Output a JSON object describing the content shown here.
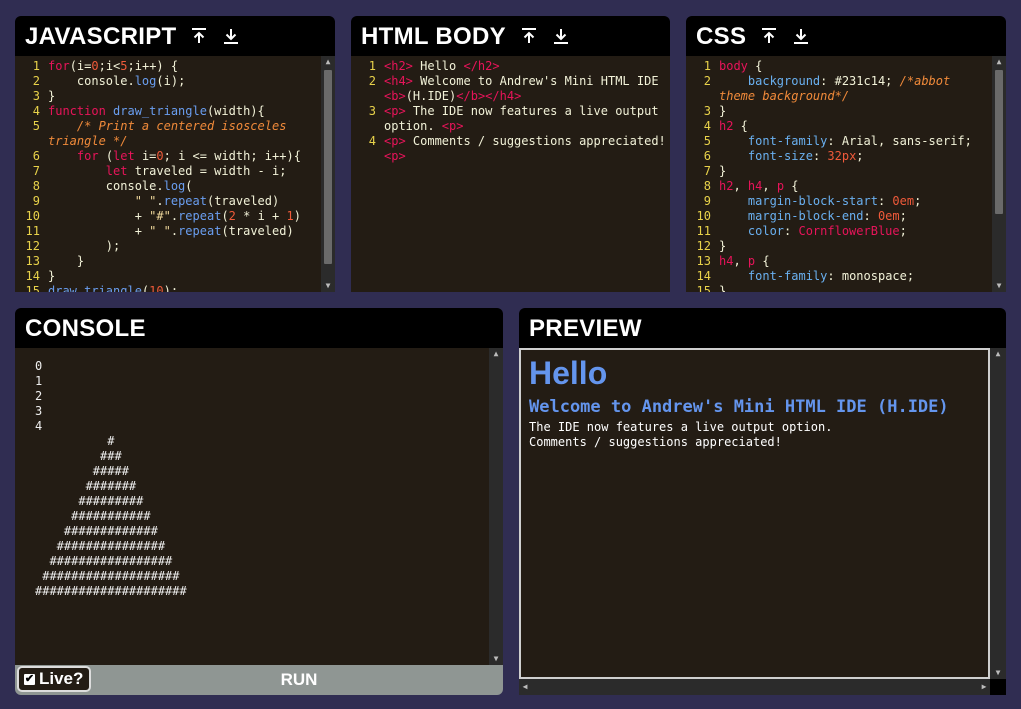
{
  "panels": {
    "javascript": {
      "title": "JAVASCRIPT",
      "lines": [
        "<span class=\"k\">for</span>(i=<span class=\"n\">0</span>;i&lt;<span class=\"n\">5</span>;i++) {",
        "    console.<span class=\"f\">log</span>(i);",
        "}",
        "<span class=\"k\">function</span> <span class=\"f\">draw_triangle</span>(width){",
        "    <span class=\"c\">/* Print a centered isosceles triangle */</span>",
        "    <span class=\"k\">for</span> (<span class=\"k\">let</span> i=<span class=\"n\">0</span>; i &lt;= width; i++){",
        "        <span class=\"k\">let</span> traveled = width - i;",
        "        console.<span class=\"f\">log</span>(",
        "            <span class=\"s\">\" \"</span>.<span class=\"f\">repeat</span>(traveled)",
        "            + <span class=\"s\">\"#\"</span>.<span class=\"f\">repeat</span>(<span class=\"n\">2</span> * i + <span class=\"n\">1</span>)",
        "            + <span class=\"s\">\" \"</span>.<span class=\"f\">repeat</span>(traveled)",
        "        );",
        "    }",
        "}",
        "<span class=\"f\">draw_triangle</span>(<span class=\"n\">10</span>);"
      ]
    },
    "html": {
      "title": "HTML BODY",
      "lines": [
        "<span class=\"tg\">&lt;h2&gt;</span> Hello <span class=\"tg\">&lt;/h2&gt;</span>",
        "<span class=\"tg\">&lt;h4&gt;</span> Welcome to Andrew's Mini HTML IDE <span class=\"tg\">&lt;b&gt;</span>(H.IDE)<span class=\"tg\">&lt;/b&gt;&lt;/h4&gt;</span>",
        "<span class=\"tg\">&lt;p&gt;</span> The IDE now features a live output option. <span class=\"tg\">&lt;p&gt;</span>",
        "<span class=\"tg\">&lt;p&gt;</span> Comments / suggestions appreciated! <span class=\"tg\">&lt;p&gt;</span>"
      ]
    },
    "css": {
      "title": "CSS",
      "lines": [
        "<span class=\"k\">body</span> {",
        "    <span class=\"pp\">background</span>: #231c14; <span class=\"c\">/*abbot theme background*/</span>",
        "}",
        "<span class=\"k\">h2</span> {",
        "    <span class=\"pp\">font-family</span>: Arial, sans-serif;",
        "    <span class=\"pp\">font-size</span>: <span class=\"n\">32px</span>;",
        "}",
        "<span class=\"k\">h2</span>, <span class=\"k\">h4</span>, <span class=\"k\">p</span> {",
        "    <span class=\"pp\">margin-block-start</span>: <span class=\"n\">0em</span>;",
        "    <span class=\"pp\">margin-block-end</span>: <span class=\"n\">0em</span>;",
        "    <span class=\"pp\">color</span>: <span class=\"v\">CornflowerBlue</span>;",
        "}",
        "<span class=\"k\">h4</span>, <span class=\"k\">p</span> {",
        "    <span class=\"pp\">font-family</span>: monospace;",
        "}"
      ]
    },
    "console": {
      "title": "CONSOLE",
      "output": "0\n1\n2\n3\n4\n          #\n         ###\n        #####\n       #######\n      #########\n     ###########\n    #############\n   ###############\n  #################\n ###################\n#####################",
      "live_label": "Live?",
      "live_checked": "✔",
      "run_label": "RUN"
    },
    "preview": {
      "title": "PREVIEW",
      "h2": "Hello",
      "h4": "Welcome to Andrew's Mini HTML IDE (H.IDE)",
      "p1": "The IDE now features a live output option.",
      "p2": "Comments / suggestions appreciated!"
    }
  },
  "icons": {
    "upload": "upload-icon",
    "download": "download-icon"
  },
  "colors": {
    "page_background": "#302d52",
    "editor_background": "#231c14",
    "preview_text": "#6495ED"
  }
}
